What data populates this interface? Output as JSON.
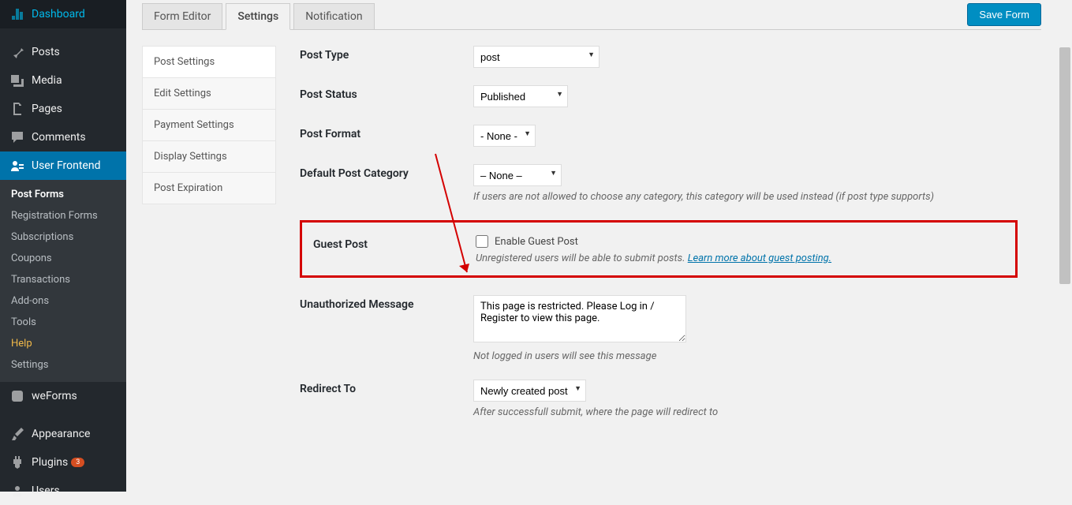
{
  "adminMenu": {
    "items": [
      {
        "label": "Dashboard"
      },
      {
        "label": "Posts"
      },
      {
        "label": "Media"
      },
      {
        "label": "Pages"
      },
      {
        "label": "Comments"
      },
      {
        "label": "User Frontend"
      }
    ],
    "submenuUF": [
      {
        "label": "Post Forms"
      },
      {
        "label": "Registration Forms"
      },
      {
        "label": "Subscriptions"
      },
      {
        "label": "Coupons"
      },
      {
        "label": "Transactions"
      },
      {
        "label": "Add-ons"
      },
      {
        "label": "Tools"
      },
      {
        "label": "Help"
      },
      {
        "label": "Settings"
      }
    ],
    "items2": [
      {
        "label": "weForms"
      },
      {
        "label": "Appearance"
      },
      {
        "label": "Plugins",
        "badge": "3"
      },
      {
        "label": "Users"
      }
    ]
  },
  "topTabs": {
    "formEditor": "Form Editor",
    "settings": "Settings",
    "notification": "Notification",
    "saveBtn": "Save Form"
  },
  "settingsNav": [
    "Post Settings",
    "Edit Settings",
    "Payment Settings",
    "Display Settings",
    "Post Expiration"
  ],
  "form": {
    "postType": {
      "label": "Post Type",
      "value": "post"
    },
    "postStatus": {
      "label": "Post Status",
      "value": "Published"
    },
    "postFormat": {
      "label": "Post Format",
      "value": "- None -"
    },
    "defaultCategory": {
      "label": "Default Post Category",
      "value": "– None –",
      "help": "If users are not allowed to choose any category, this category will be used instead (if post type supports)"
    },
    "guestPost": {
      "label": "Guest Post",
      "checkbox": "Enable Guest Post",
      "help": "Unregistered users will be able to submit posts. ",
      "link": "Learn more about guest posting."
    },
    "unauthMsg": {
      "label": "Unauthorized Message",
      "value": "This page is restricted. Please Log in / Register to view this page.",
      "help": "Not logged in users will see this message"
    },
    "redirectTo": {
      "label": "Redirect To",
      "value": "Newly created post",
      "help": "After successfull submit, where the page will redirect to"
    }
  }
}
